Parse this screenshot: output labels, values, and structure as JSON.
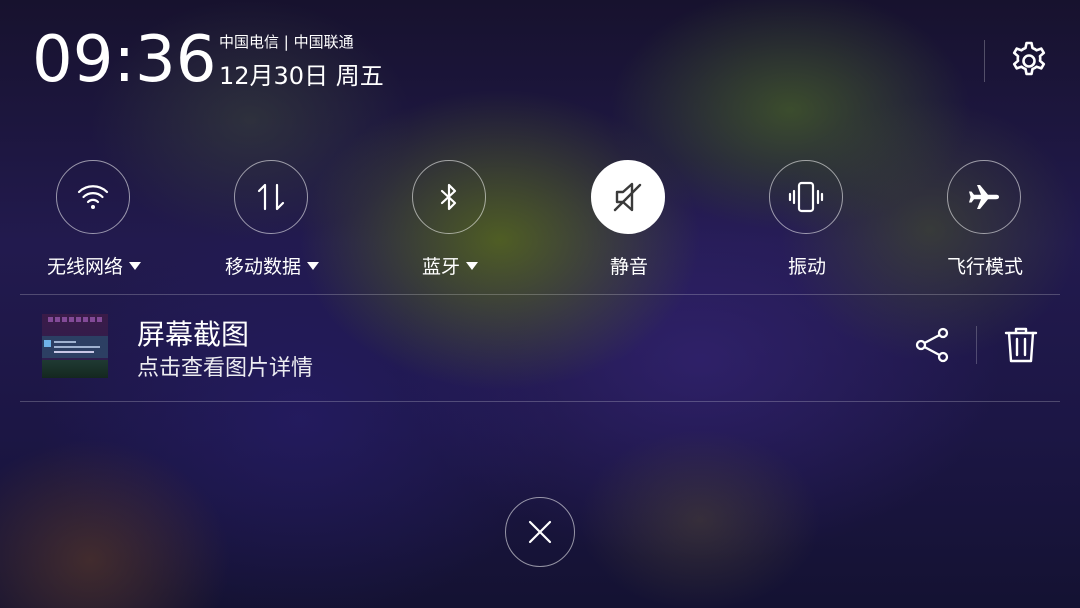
{
  "status": {
    "time": "09:36",
    "carrier": "中国电信 | 中国联通",
    "date": "12月30日 周五",
    "settings_icon": "gear-icon"
  },
  "toggles": [
    {
      "label": "无线网络",
      "icon": "wifi-icon",
      "active": false,
      "has_dropdown": true
    },
    {
      "label": "移动数据",
      "icon": "mobile-data-icon",
      "active": false,
      "has_dropdown": true
    },
    {
      "label": "蓝牙",
      "icon": "bluetooth-icon",
      "active": false,
      "has_dropdown": true
    },
    {
      "label": "静音",
      "icon": "mute-icon",
      "active": true,
      "has_dropdown": false
    },
    {
      "label": "振动",
      "icon": "vibrate-icon",
      "active": false,
      "has_dropdown": false
    },
    {
      "label": "飞行模式",
      "icon": "airplane-icon",
      "active": false,
      "has_dropdown": false
    }
  ],
  "notification": {
    "title": "屏幕截图",
    "subtitle": "点击查看图片详情",
    "share_icon": "share-icon",
    "delete_icon": "trash-icon"
  },
  "close_icon": "close-icon",
  "colors": {
    "text": "#ffffff",
    "active_toggle_bg": "#ffffff",
    "active_toggle_icon": "#3a3a3a"
  }
}
